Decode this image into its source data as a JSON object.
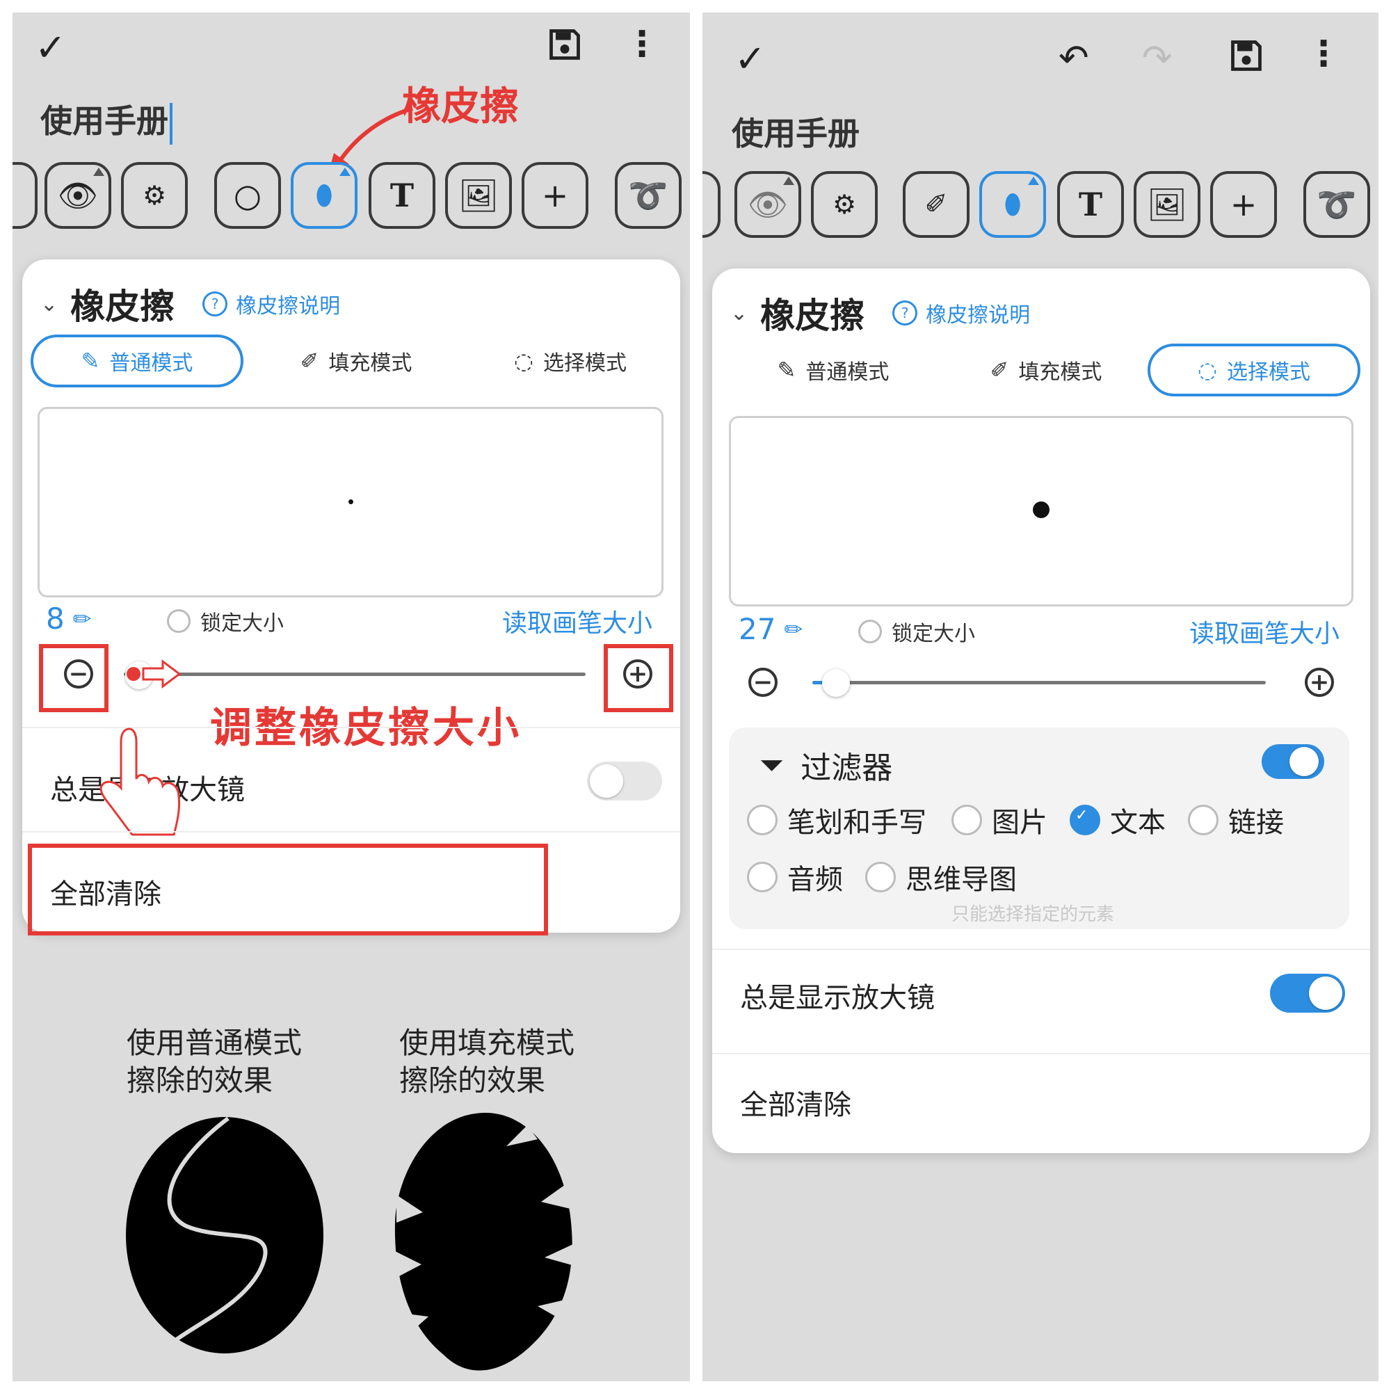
{
  "left": {
    "doc_title": "使用手册",
    "panel_title": "橡皮擦",
    "help_link": "橡皮擦说明",
    "modes": [
      "普通模式",
      "填充模式",
      "选择模式"
    ],
    "size_value": "8",
    "lock_size": "锁定大小",
    "read_pen_size": "读取画笔大小",
    "magnifier": "总是显示放大镜",
    "clear_all": "全部清除",
    "annotation_eraser": "橡皮擦",
    "annotation_adjust": "调整橡皮擦大小",
    "caption_normal": [
      "使用普通模式",
      "擦除的效果"
    ],
    "caption_fill": [
      "使用填充模式",
      "擦除的效果"
    ]
  },
  "right": {
    "doc_title": "使用手册",
    "panel_title": "橡皮擦",
    "help_link": "橡皮擦说明",
    "modes": [
      "普通模式",
      "填充模式",
      "选择模式"
    ],
    "size_value": "27",
    "lock_size": "锁定大小",
    "read_pen_size": "读取画笔大小",
    "filter_title": "过滤器",
    "filter_options": [
      "笔划和手写",
      "图片",
      "文本",
      "链接",
      "音频",
      "思维导图"
    ],
    "filter_checked": "文本",
    "filter_hint": "只能选择指定的元素",
    "magnifier": "总是显示放大镜",
    "clear_all": "全部清除"
  },
  "colors": {
    "accent": "#2d8de0",
    "annotation": "#e53935",
    "background": "#dcdcdc"
  },
  "icons": [
    "check-icon",
    "save-icon",
    "more-icon",
    "undo-icon",
    "redo-icon",
    "eye-icon",
    "settings-page-icon",
    "circle-icon",
    "eraser-icon",
    "text-icon",
    "image-icon",
    "plus-icon",
    "lasso-icon",
    "help-icon",
    "filter-icon",
    "minus-circle-icon",
    "plus-circle-icon",
    "pencil-icon"
  ]
}
